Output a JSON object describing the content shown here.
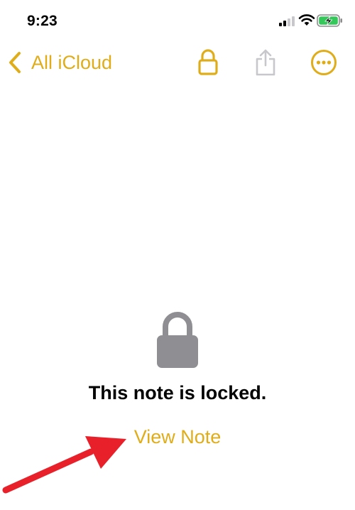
{
  "status_bar": {
    "time": "9:23"
  },
  "nav": {
    "back_label": "All iCloud"
  },
  "locked_view": {
    "title": "This note is locked.",
    "view_note_label": "View Note"
  },
  "colors": {
    "accent": "#e0ad1a",
    "lock_gray": "#8e8e93",
    "annotation_arrow": "#e8202a",
    "battery_green": "#34c759"
  },
  "icons": {
    "signal": "cellular-signal-icon",
    "wifi": "wifi-icon",
    "battery": "battery-charging-icon",
    "back": "chevron-left-icon",
    "lock": "lock-icon",
    "share": "share-icon",
    "more": "ellipsis-circle-icon"
  }
}
